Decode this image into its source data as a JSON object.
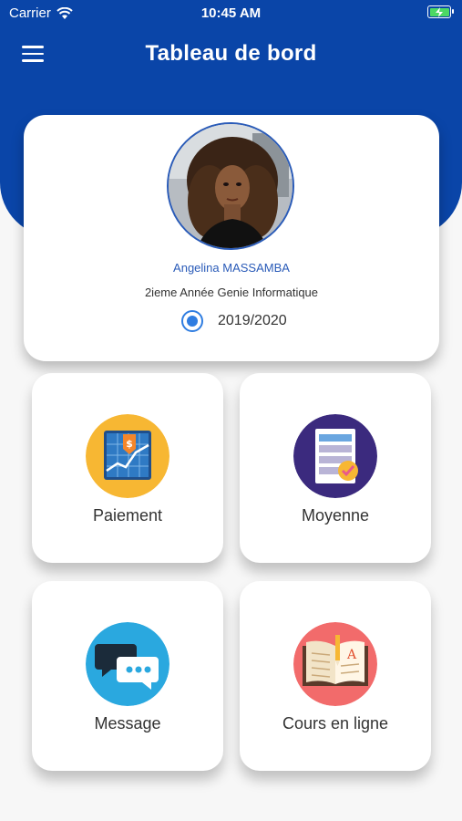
{
  "status_bar": {
    "carrier": "Carrier",
    "time": "10:45 AM",
    "battery_icon": "battery-charging-icon",
    "signal_icon": "wifi-icon"
  },
  "header": {
    "title": "Tableau de bord",
    "menu_icon": "hamburger-menu-icon",
    "color": "#0a45a8"
  },
  "profile": {
    "name": "Angelina MASSAMBA",
    "class": "2ieme Année Genie Informatique",
    "year": "2019/2020",
    "year_selected": true
  },
  "tiles": [
    {
      "label": "Paiement",
      "icon": "payment-chart-icon",
      "icon_bg": "#f7b733"
    },
    {
      "label": "Moyenne",
      "icon": "grades-checklist-icon",
      "icon_bg": "#3b2a7e"
    },
    {
      "label": "Message",
      "icon": "chat-bubbles-icon",
      "icon_bg": "#2aa8df"
    },
    {
      "label": "Cours en ligne",
      "icon": "open-book-icon",
      "icon_bg": "#f26b6b"
    }
  ]
}
